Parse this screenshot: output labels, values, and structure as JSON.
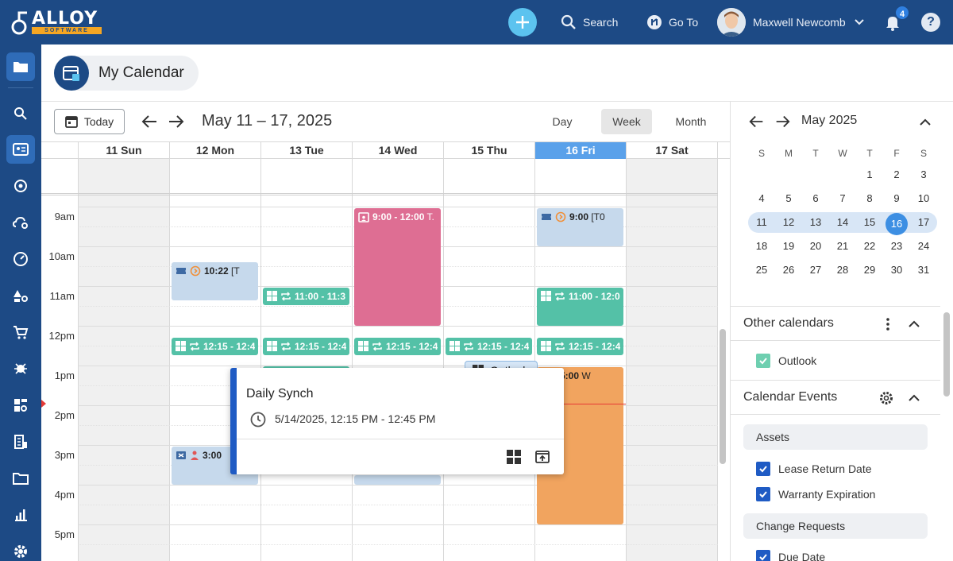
{
  "brand": {
    "name": "ALLOY",
    "tagline": "SOFTWARE"
  },
  "topbar": {
    "search_label": "Search",
    "goto_label": "Go To",
    "user_name": "Maxwell Newcomb",
    "notification_count": "4",
    "help_label": "?"
  },
  "page": {
    "title": "My Calendar"
  },
  "toolbar": {
    "today_label": "Today",
    "range_label": "May 11 – 17, 2025",
    "views": [
      "Day",
      "Week",
      "Month"
    ],
    "active_view": "Week"
  },
  "days": [
    "11 Sun",
    "12 Mon",
    "13 Tue",
    "14 Wed",
    "15 Thu",
    "16 Fri",
    "17 Sat"
  ],
  "today_column": "16 Fri",
  "times": [
    "9am",
    "10am",
    "11am",
    "12pm",
    "1pm",
    "2pm",
    "3pm",
    "4pm",
    "5pm"
  ],
  "events": [
    {
      "day": "12 Mon",
      "bold": "10:22",
      "rest": " [T",
      "color": "blue"
    },
    {
      "day": "12 Mon",
      "bold": "12:15 - 12:4",
      "rest": "",
      "color": "teal"
    },
    {
      "day": "12 Mon",
      "bold": "3:00",
      "rest": "",
      "color": "blue"
    },
    {
      "day": "13 Tue",
      "bold": "11:00 - 11:3",
      "rest": "",
      "color": "teal"
    },
    {
      "day": "13 Tue",
      "bold": "12:15 - 12:4",
      "rest": "",
      "color": "teal"
    },
    {
      "day": "14 Wed",
      "bold": "9:00 - 12:00",
      "rest": " T.",
      "color": "pink"
    },
    {
      "day": "14 Wed",
      "bold": "12:15 - 12:4",
      "rest": "",
      "color": "teal"
    },
    {
      "day": "15 Thu",
      "bold": "12:15 - 12:4",
      "rest": "",
      "color": "teal"
    },
    {
      "day": "16 Fri",
      "bold": "9:00",
      "rest": " [T0",
      "color": "blue"
    },
    {
      "day": "16 Fri",
      "bold": "11:00 - 12:0",
      "rest": "",
      "color": "teal"
    },
    {
      "day": "16 Fri",
      "bold": "12:15 - 12:4",
      "rest": "",
      "color": "teal"
    },
    {
      "day": "16 Fri",
      "bold": "00 - 5:00",
      "rest": " W",
      "color": "orange"
    }
  ],
  "popup": {
    "source": "Outlook",
    "title": "Daily Synch",
    "time": "5/14/2025, 12:15 PM - 12:45 PM"
  },
  "mini_calendar": {
    "month_label": "May 2025",
    "dow": [
      "S",
      "M",
      "T",
      "W",
      "T",
      "F",
      "S"
    ],
    "weeks": [
      [
        "",
        "",
        "",
        "",
        "1",
        "2",
        "3"
      ],
      [
        "4",
        "5",
        "6",
        "7",
        "8",
        "9",
        "10"
      ],
      [
        "11",
        "12",
        "13",
        "14",
        "15",
        "16",
        "17"
      ],
      [
        "18",
        "19",
        "20",
        "21",
        "22",
        "23",
        "24"
      ],
      [
        "25",
        "26",
        "27",
        "28",
        "29",
        "30",
        "31"
      ]
    ],
    "selected_day": "16"
  },
  "other_calendars": {
    "title": "Other calendars",
    "items": [
      {
        "label": "Outlook",
        "checked": true
      }
    ]
  },
  "calendar_events": {
    "title": "Calendar Events",
    "groups": [
      {
        "title": "Assets",
        "items": [
          "Lease Return Date",
          "Warranty Expiration"
        ]
      },
      {
        "title": "Change Requests",
        "items": [
          "Due Date"
        ]
      }
    ]
  },
  "colors": {
    "topbar": "#1d4a85",
    "accent": "#5cc3ef",
    "event_blue": "#c6d9ec",
    "event_teal": "#54c1a7",
    "event_pink": "#de6e93",
    "event_orange": "#f1a45f",
    "today_header": "#5aa1ea"
  }
}
